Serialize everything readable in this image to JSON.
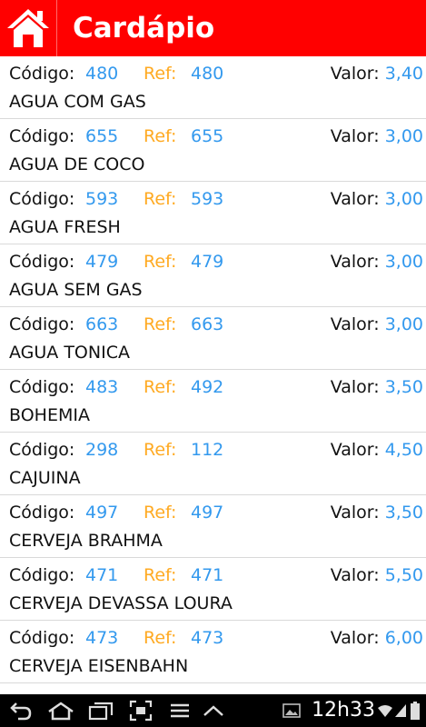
{
  "header": {
    "title": "Cardápio"
  },
  "labels": {
    "codigo": "Código:",
    "ref": "Ref:",
    "valor": "Valor:"
  },
  "items": [
    {
      "codigo": "480",
      "ref": "480",
      "valor": "3,40",
      "nome": "AGUA COM GAS"
    },
    {
      "codigo": "655",
      "ref": "655",
      "valor": "3,00",
      "nome": "AGUA DE COCO"
    },
    {
      "codigo": "593",
      "ref": "593",
      "valor": "3,00",
      "nome": "AGUA FRESH"
    },
    {
      "codigo": "479",
      "ref": "479",
      "valor": "3,00",
      "nome": "AGUA SEM GAS"
    },
    {
      "codigo": "663",
      "ref": "663",
      "valor": "3,00",
      "nome": "AGUA TONICA"
    },
    {
      "codigo": "483",
      "ref": "492",
      "valor": "3,50",
      "nome": "BOHEMIA"
    },
    {
      "codigo": "298",
      "ref": "112",
      "valor": "4,50",
      "nome": "CAJUINA"
    },
    {
      "codigo": "497",
      "ref": "497",
      "valor": "3,50",
      "nome": "CERVEJA BRAHMA"
    },
    {
      "codigo": "471",
      "ref": "471",
      "valor": "5,50",
      "nome": "CERVEJA DEVASSA LOURA"
    },
    {
      "codigo": "473",
      "ref": "473",
      "valor": "6,00",
      "nome": "CERVEJA EISENBAHN"
    }
  ],
  "status": {
    "time": "12h33"
  },
  "colors": {
    "header_bg": "#ff0000",
    "value_blue": "#3399ee",
    "ref_orange": "#ffaa22"
  },
  "icons": [
    "home-icon",
    "back-icon",
    "home-nav-icon",
    "recent-apps-icon",
    "screenshot-icon",
    "menu-icon",
    "up-chevron-icon",
    "gallery-icon",
    "wifi-icon",
    "signal-icon",
    "battery-icon"
  ]
}
